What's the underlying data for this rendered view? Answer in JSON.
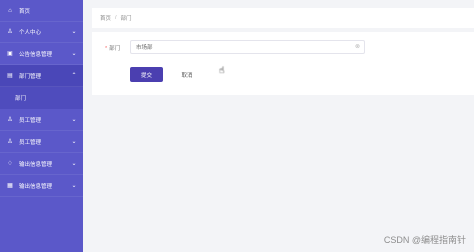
{
  "sidebar": {
    "items": [
      {
        "icon": "⌂",
        "label": "首页",
        "arrow": ""
      },
      {
        "icon": "♙",
        "label": "个人中心",
        "arrow": "⌄"
      },
      {
        "icon": "▣",
        "label": "公告信息管理",
        "arrow": "⌄"
      },
      {
        "icon": "▤",
        "label": "部门管理",
        "arrow": "⌃"
      },
      {
        "icon": "",
        "label": "部门",
        "arrow": ""
      },
      {
        "icon": "♙",
        "label": "员工管理",
        "arrow": "⌄"
      },
      {
        "icon": "♙",
        "label": "员工管理",
        "arrow": "⌄"
      },
      {
        "icon": "♢",
        "label": "输出信息管理",
        "arrow": "⌄"
      },
      {
        "icon": "▦",
        "label": "输出信息管理",
        "arrow": "⌄"
      }
    ]
  },
  "breadcrumb": {
    "home": "首页",
    "separator": "/",
    "current": "部门"
  },
  "form": {
    "required_mark": "*",
    "field_label": "部门",
    "field_value": "市场部",
    "clear_icon": "⊗",
    "submit_label": "提交",
    "cancel_label": "取消"
  },
  "watermark": "CSDN @编程指南针",
  "colors": {
    "sidebar": "#5b58c9",
    "primary_button": "#4b3fb0",
    "required": "#f56c6c"
  }
}
